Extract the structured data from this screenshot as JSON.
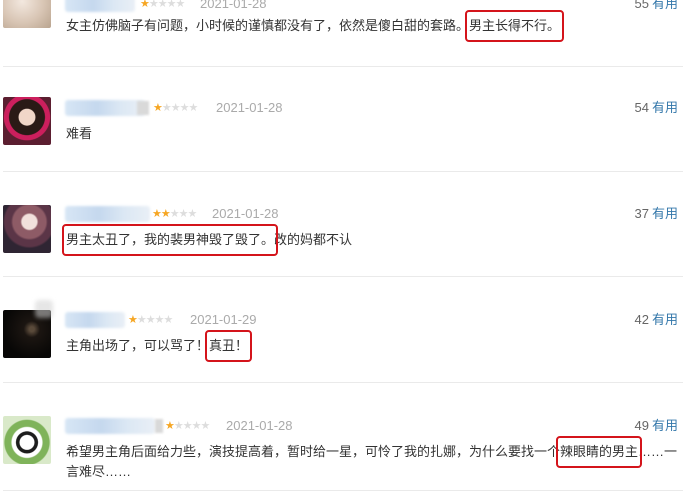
{
  "reviews": [
    {
      "date": "2021-01-28",
      "votes_count": "55",
      "useful_label": "有用",
      "rating": 1,
      "comment_before": "女主仿佛脑子有问题，小时候的谨慎都没有了，依然是傻白甜的套路。",
      "comment_highlight": "男主长得不行。",
      "comment_after": ""
    },
    {
      "date": "2021-01-28",
      "votes_count": "54",
      "useful_label": "有用",
      "rating": 1,
      "comment_before": "难看",
      "comment_highlight": "",
      "comment_after": ""
    },
    {
      "date": "2021-01-28",
      "votes_count": "37",
      "useful_label": "有用",
      "rating": 2,
      "comment_before": "",
      "comment_highlight": "男主太丑了，我的裴男神毁了毁了。",
      "comment_after": "改的妈都不认"
    },
    {
      "date": "2021-01-29",
      "votes_count": "42",
      "useful_label": "有用",
      "rating": 1,
      "comment_before": "主角出场了，可以骂了！",
      "comment_highlight": "真丑！",
      "comment_after": ""
    },
    {
      "date": "2021-01-28",
      "votes_count": "49",
      "useful_label": "有用",
      "rating": 1,
      "comment_before": "希望男主角后面给力些，演技提高着，暂时给一星，可怜了我的扎娜，为什么要找一个",
      "comment_highlight": "辣眼睛的男主",
      "comment_after": "……一",
      "comment_line2": "言难尽……"
    }
  ],
  "colors": {
    "useful_link": "#3377aa",
    "highlight_box": "#d4141b",
    "star_on": "#f6a623",
    "star_off": "#dddddd",
    "date": "#aaaaaa"
  },
  "icons": [
    "star-rating-icon",
    "user-badge-icon"
  ]
}
